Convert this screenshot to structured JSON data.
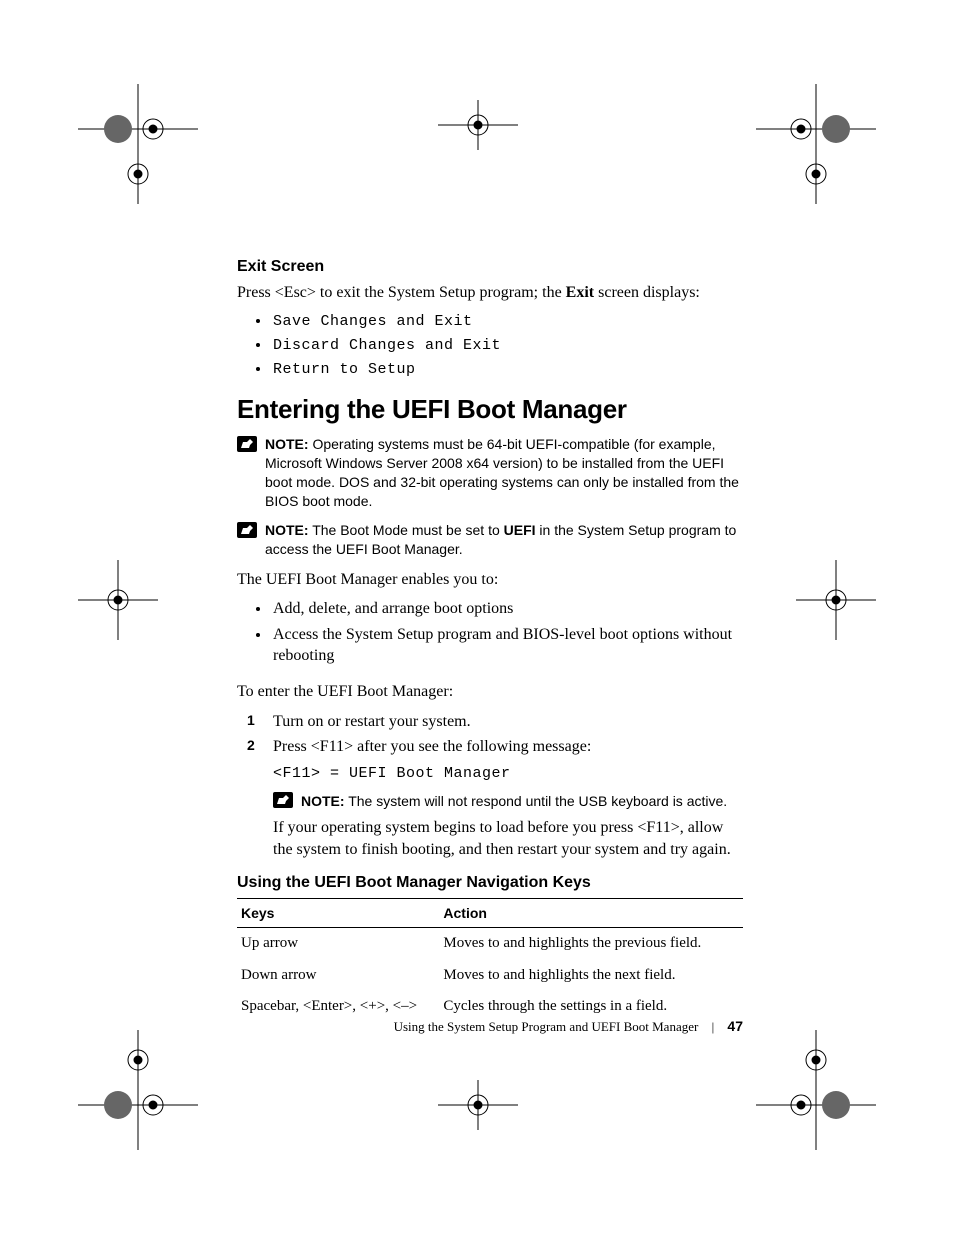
{
  "exit": {
    "heading": "Exit Screen",
    "intro_pre": "Press <Esc> to exit the System Setup program; the ",
    "intro_bold": "Exit",
    "intro_post": " screen displays:",
    "options": [
      "Save Changes and Exit",
      "Discard Changes and Exit",
      "Return to Setup"
    ]
  },
  "section_heading": "Entering the UEFI Boot Manager",
  "note_label": "NOTE:",
  "note1": "Operating systems must be 64-bit UEFI-compatible (for example, Microsoft Windows Server 2008 x64 version) to be installed from the UEFI boot mode. DOS and 32-bit operating systems can only be installed from the BIOS boot mode.",
  "note2_pre": "The Boot Mode must be set to ",
  "note2_bold": "UEFI",
  "note2_post": " in the System Setup program to access the UEFI Boot Manager.",
  "enables_intro": "The UEFI Boot Manager enables you to:",
  "enables": [
    "Add, delete, and arrange boot options",
    "Access the System Setup program and BIOS-level boot options without rebooting"
  ],
  "enter_intro": "To enter the UEFI Boot Manager:",
  "steps": {
    "s1": "Turn on or restart your system.",
    "s2": "Press <F11> after you see the following message:",
    "s2_code": "<F11> = UEFI Boot Manager",
    "s2_note": "The system will not respond until the USB keyboard is active.",
    "s2_tail": "If your operating system begins to load before you press <F11>, allow the system to finish booting, and then restart your system and try again."
  },
  "navkeys_heading": "Using the UEFI Boot Manager Navigation Keys",
  "table": {
    "headers": [
      "Keys",
      "Action"
    ],
    "rows": [
      [
        "Up arrow",
        "Moves to and highlights the previous field."
      ],
      [
        "Down arrow",
        "Moves to and highlights the next field."
      ],
      [
        "Spacebar, <Enter>, <+>, <–>",
        "Cycles through the settings in a field."
      ]
    ]
  },
  "footer": {
    "title": "Using the System Setup Program and UEFI Boot Manager",
    "page": "47"
  }
}
